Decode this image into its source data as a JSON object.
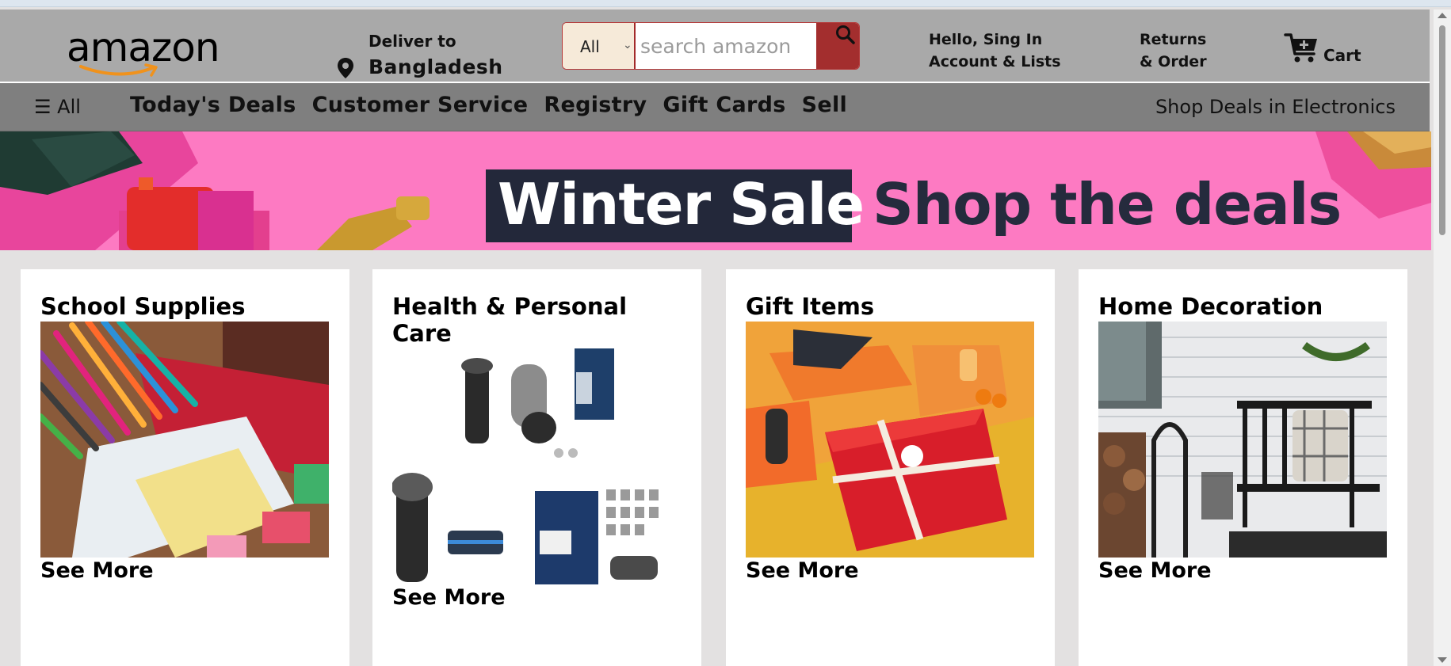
{
  "header": {
    "logo_text": "amazon",
    "deliver_label": "Deliver to",
    "deliver_location": "Bangladesh",
    "search": {
      "category_selected": "All",
      "placeholder": "search amazon"
    },
    "account_line1": "Hello, Sing In",
    "account_line2": "Account & Lists",
    "returns_line1": "Returns",
    "returns_line2": "& Order",
    "cart_label": "Cart"
  },
  "nav": {
    "all_label": "☰ All",
    "links": [
      "Today's Deals",
      "Customer Service",
      "Registry",
      "Gift Cards",
      "Sell"
    ],
    "shop_deals": "Shop Deals in Electronics"
  },
  "banner": {
    "highlight": "Winter Sale",
    "text": "Shop the deals",
    "background": "#fd7ac2"
  },
  "cards": [
    {
      "title": "School Supplies",
      "see_more": "See More"
    },
    {
      "title": "Health & Personal Care",
      "see_more": "See More"
    },
    {
      "title": "Gift Items",
      "see_more": "See More"
    },
    {
      "title": "Home Decoration",
      "see_more": "See More"
    }
  ],
  "colors": {
    "header_bg": "#a9a9a9",
    "nav_bg": "#7f7f7f",
    "search_button": "#a32e2e",
    "page_bg": "#e3e1e1"
  }
}
